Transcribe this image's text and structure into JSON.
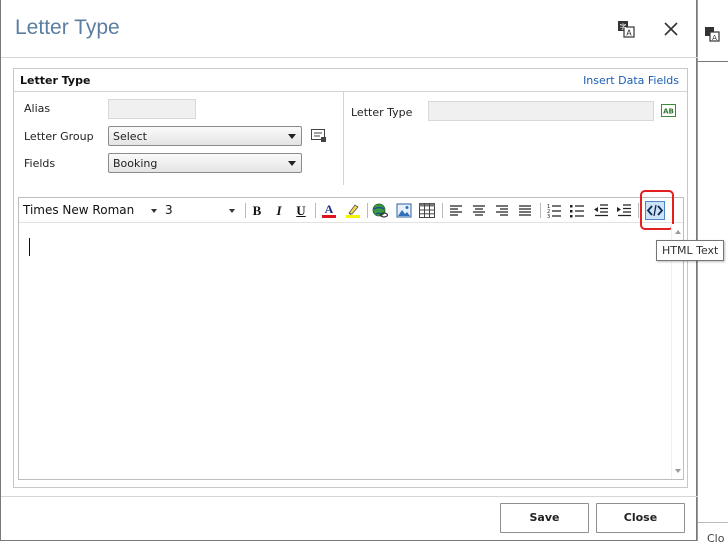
{
  "dialog": {
    "title": "Letter Type"
  },
  "panel": {
    "title": "Letter Type",
    "insert_link": "Insert Data Fields"
  },
  "form": {
    "alias_label": "Alias",
    "alias_value": "",
    "letter_group_label": "Letter Group",
    "letter_group_value": "Select",
    "fields_label": "Fields",
    "fields_value": "Booking",
    "letter_type_label": "Letter Type",
    "letter_type_value": ""
  },
  "toolbar": {
    "font_name": "Times New Roman",
    "font_size": "3",
    "bold": "B",
    "italic": "I",
    "underline": "U",
    "html_tooltip": "HTML Text"
  },
  "colors": {
    "title": "#5b7ea0",
    "link": "#1a5fb4",
    "highlight_box": "#e32020",
    "font_color_bar": "#e0141e",
    "highlight_color_bar": "#f4f400"
  },
  "footer": {
    "save_label": "Save",
    "close_label": "Close"
  },
  "background": {
    "partial_text": "Clo"
  }
}
